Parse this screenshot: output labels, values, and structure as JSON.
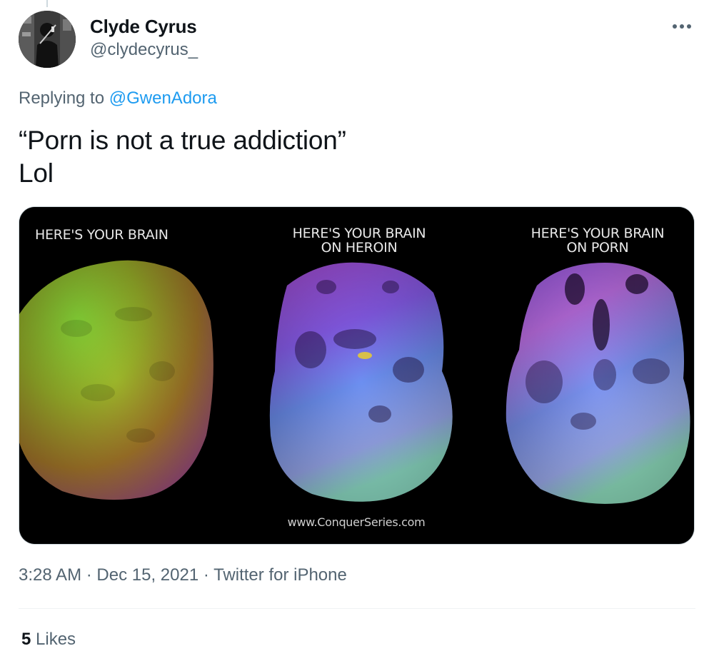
{
  "tweet": {
    "author": {
      "display_name": "Clyde Cyrus",
      "handle": "@clydecyrus_"
    },
    "reply": {
      "prefix": "Replying to",
      "to": "@GwenAdora"
    },
    "text_lines": [
      "“Porn is not a true addiction”",
      "Lol"
    ],
    "media": {
      "captions": {
        "brain": "HERE'S YOUR BRAIN",
        "heroin_l1": "HERE'S YOUR BRAIN",
        "heroin_l2": "ON HEROIN",
        "porn_l1": "HERE'S YOUR BRAIN",
        "porn_l2": "ON PORN"
      },
      "watermark": "www.ConquerSeries.com"
    },
    "meta": {
      "time": "3:28 AM",
      "date": "Dec 15, 2021",
      "source": "Twitter for iPhone",
      "separator": "·"
    },
    "likes": {
      "count": "5",
      "label": "Likes"
    },
    "colors": {
      "link": "#1d9bf0",
      "secondary_text": "#536471",
      "primary_text": "#0f1419"
    },
    "icons": [
      "more-icon"
    ]
  }
}
